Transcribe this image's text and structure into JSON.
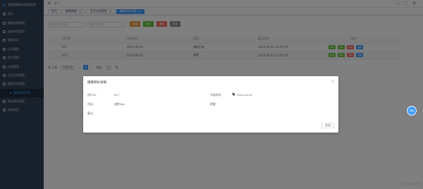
{
  "sidebar": {
    "logo_text": "智能健康移动管理系统",
    "items": [
      {
        "label": "首页",
        "icon": "home-icon"
      },
      {
        "label": "健康监测管理",
        "icon": "monitor-icon"
      },
      {
        "label": "疾病风险管理",
        "icon": "risk-icon"
      },
      {
        "label": "健康问诊",
        "icon": "consult-icon"
      },
      {
        "label": "运动管理",
        "icon": "sport-icon"
      },
      {
        "label": "用户管理",
        "icon": "user-icon"
      },
      {
        "label": "饮食管理",
        "icon": "diet-icon"
      },
      {
        "label": "生活记录管理",
        "icon": "record-icon"
      },
      {
        "label": "健康目标管理",
        "icon": "target-icon"
      },
      {
        "label": "健康目标详情",
        "icon": "dot",
        "sub": true
      },
      {
        "label": "服务通知管理",
        "icon": "notice-icon"
      },
      {
        "label": "系统监控",
        "icon": "system-icon"
      }
    ]
  },
  "navbar": {
    "breadcrumb": "首页",
    "right_icons": [
      "search-icon",
      "fullscreen-icon",
      "settings-icon"
    ]
  },
  "tags": [
    {
      "label": "首页",
      "active": false
    },
    {
      "label": "健康数据",
      "active": false
    },
    {
      "label": "生活记录管理",
      "active": false
    },
    {
      "label": "健康目标详情",
      "active": true
    }
  ],
  "search": {
    "placeholder1": "请输入用户ID",
    "placeholder2": "请输入目标"
  },
  "toolbar": {
    "add": "新增",
    "edit": "修改",
    "delete": "删除",
    "export": "导出"
  },
  "table": {
    "headers": [
      "用户ID",
      "开始时间",
      "目标",
      "截止时间",
      "操作"
    ],
    "rows": [
      {
        "id": "617",
        "start": "2024-05-01",
        "goal": "减肥目标",
        "end": "2024-05-01 11:07:07"
      },
      {
        "id": "617",
        "start": "2024-04-01",
        "goal": "减肥",
        "end": "2024-05-01 11:07:00"
      }
    ],
    "row_actions": [
      "修改",
      "删除",
      "详情",
      "提醒"
    ]
  },
  "pager": {
    "total": "共 2 条",
    "size": "10条/页",
    "page": "1",
    "goto": "前往",
    "goto_page": "1",
    "unit": "页"
  },
  "dialog": {
    "title": "健康目标详情",
    "user_label": "用户ID：",
    "user_value": "617",
    "start_label": "开始时间：",
    "start_value": "2024-04-01",
    "goal_label": "目标：",
    "goal_value": "减肥5kg",
    "tip_label": "提醒：",
    "remark_label": "备注：",
    "cancel": "关闭"
  },
  "float_button": "帮助",
  "watermark": "CSDN @程序员"
}
